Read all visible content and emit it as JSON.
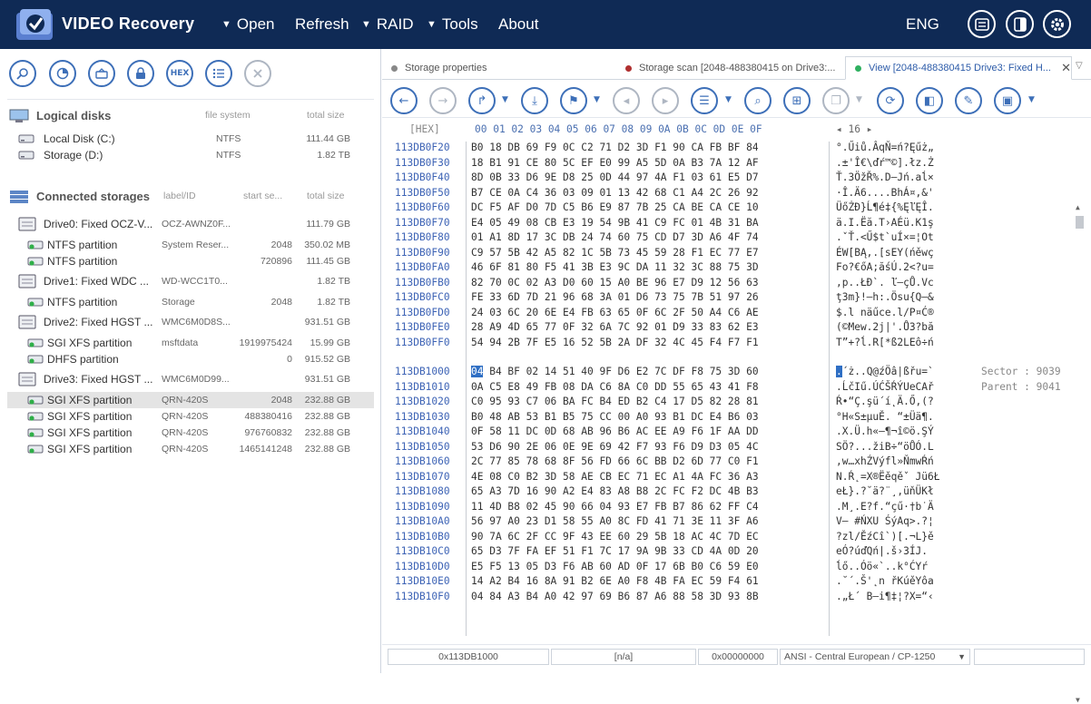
{
  "app": {
    "title": "VIDEO Recovery"
  },
  "menu": [
    {
      "label": "Open",
      "has_arrow": true
    },
    {
      "label": "Refresh",
      "has_arrow": false
    },
    {
      "label": "RAID",
      "has_arrow": true
    },
    {
      "label": "Tools",
      "has_arrow": true
    },
    {
      "label": "About",
      "has_arrow": false
    }
  ],
  "lang": "ENG",
  "left_toolbar": {
    "hex_label": "HEX"
  },
  "logical": {
    "title": "Logical disks",
    "col_fs": "file system",
    "col_size": "total size",
    "items": [
      {
        "name": "Local Disk (C:)",
        "fs": "NTFS",
        "size": "111.44 GB"
      },
      {
        "name": "Storage (D:)",
        "fs": "NTFS",
        "size": "1.82 TB"
      }
    ]
  },
  "storages": {
    "title": "Connected storages",
    "col_label": "label/ID",
    "col_start": "start se...",
    "col_size": "total size",
    "items": [
      {
        "kind": "drive",
        "name": "Drive0: Fixed OCZ-V...",
        "label": "OCZ-AWNZ0F...",
        "start": "",
        "size": "111.79 GB"
      },
      {
        "kind": "part",
        "name": "NTFS partition",
        "label": "System Reser...",
        "start": "2048",
        "size": "350.02 MB"
      },
      {
        "kind": "part",
        "name": "NTFS partition",
        "label": "",
        "start": "720896",
        "size": "111.45 GB"
      },
      {
        "kind": "drive",
        "name": "Drive1: Fixed WDC ...",
        "label": "WD-WCC1T0...",
        "start": "",
        "size": "1.82 TB"
      },
      {
        "kind": "part",
        "name": "NTFS partition",
        "label": "Storage",
        "start": "2048",
        "size": "1.82 TB"
      },
      {
        "kind": "drive",
        "name": "Drive2: Fixed HGST ...",
        "label": "WMC6M0D8S...",
        "start": "",
        "size": "931.51 GB"
      },
      {
        "kind": "part",
        "name": "SGI XFS partition",
        "label": "msftdata",
        "start": "1919975424",
        "size": "15.99 GB"
      },
      {
        "kind": "part",
        "name": "DHFS partition",
        "label": "",
        "start": "0",
        "size": "915.52 GB"
      },
      {
        "kind": "drive",
        "name": "Drive3: Fixed HGST ...",
        "label": "WMC6M0D99...",
        "start": "",
        "size": "931.51 GB"
      },
      {
        "kind": "part",
        "name": "SGI XFS partition",
        "label": "QRN-420S",
        "start": "2048",
        "size": "232.88 GB",
        "selected": true
      },
      {
        "kind": "part",
        "name": "SGI XFS partition",
        "label": "QRN-420S",
        "start": "488380416",
        "size": "232.88 GB"
      },
      {
        "kind": "part",
        "name": "SGI XFS partition",
        "label": "QRN-420S",
        "start": "976760832",
        "size": "232.88 GB"
      },
      {
        "kind": "part",
        "name": "SGI XFS partition",
        "label": "QRN-420S",
        "start": "1465141248",
        "size": "232.88 GB"
      }
    ]
  },
  "tabs": [
    {
      "label": "Storage properties",
      "color": "#888888"
    },
    {
      "label": "Storage scan [2048-488380415 on Drive3:...",
      "color": "#b03030"
    },
    {
      "label": "View [2048-488380415 Drive3: Fixed H...",
      "color": "#2fb060",
      "active": true
    }
  ],
  "hex": {
    "header_label": "[HEX]",
    "columns": "00 01 02 03 04 05 06 07 08 09 0A 0B 0C 0D 0E 0F",
    "page_indicator": "◂ 16 ▸",
    "block1": [
      {
        "addr": "113DB0F20",
        "bytes": "B0 18 DB 69 F9 0C C2 71 D2 3D F1 90 CA FB BF 84",
        "text": "°.Űiů.ÂqŇ=ń?Ęűż„"
      },
      {
        "addr": "113DB0F30",
        "bytes": "18 B1 91 CE 80 5C EF E0 99 A5 5D 0A B3 7A 12 AF",
        "text": ".±'Î€\\ďŕ™©].łz.Ż"
      },
      {
        "addr": "113DB0F40",
        "bytes": "8D 0B 33 D6 9E D8 25 0D 44 97 4A F1 03 61 E5 D7",
        "text": "Ť.3ÖžŘ%.D—Jń.aĺ×"
      },
      {
        "addr": "113DB0F50",
        "bytes": "B7 CE 0A C4 36 03 09 01 13 42 68 C1 A4 2C 26 92",
        "text": "·Î.Ä6....BhÁ¤,&'"
      },
      {
        "addr": "113DB0F60",
        "bytes": "DC F5 AF D0 7D C5 B6 E9 87 7B 25 CA BE CA CE 10",
        "text": "ÜőŻĐ}Ĺ¶é‡{%ĘľĘÎ."
      },
      {
        "addr": "113DB0F70",
        "bytes": "E4 05 49 08 CB E3 19 54 9B 41 C9 FC 01 4B 31 BA",
        "text": "ä.I.Ëă.T›AÉü.K1ş"
      },
      {
        "addr": "113DB0F80",
        "bytes": "01 A1 8D 17 3C DB 24 74 60 75 CD D7 3D A6 4F 74",
        "text": ".ˇŤ.<Ű$t`uÍ×=¦Ot"
      },
      {
        "addr": "113DB0F90",
        "bytes": "C9 57 5B 42 A5 82 1C 5B 73 45 59 28 F1 EC 77 E7",
        "text": "ÉW[BĄ‚.[sEY(ńěwç"
      },
      {
        "addr": "113DB0FA0",
        "bytes": "46 6F 81 80 F5 41 3B E3 9C DA 11 32 3C 88 75 3D",
        "text": "Fo?€őA;ăśÚ.2<?u="
      },
      {
        "addr": "113DB0FB0",
        "bytes": "82 70 0C 02 A3 D0 60 15 A0 BE 96 E7 D9 12 56 63",
        "text": "‚p..ŁĐ`. ľ–çŮ.Vc"
      },
      {
        "addr": "113DB0FC0",
        "bytes": "FE 33 6D 7D 21 96 68 3A 01 D6 73 75 7B 51 97 26",
        "text": "ţ3m}!–h:.Ösu{Q—&"
      },
      {
        "addr": "113DB0FD0",
        "bytes": "24 03 6C 20 6E E4 FB 63 65 0F 6C 2F 50 A4 C6 AE",
        "text": "$.l näűce.l/P¤Ć®"
      },
      {
        "addr": "113DB0FE0",
        "bytes": "28 A9 4D 65 77 0F 32 6A 7C 92 01 D9 33 83 62 E3",
        "text": "(©Mew.2j|'.Ů3?bă"
      },
      {
        "addr": "113DB0FF0",
        "bytes": "54 94 2B 7F E5 16 52 5B 2A DF 32 4C 45 F4 F7 F1",
        "text": "T”+?ĺ.R[*ß2LEô÷ń"
      }
    ],
    "block2": [
      {
        "addr": "113DB1000",
        "first": "04",
        "bytes": " B4 BF 02 14 51 40 9F D6 E2 7C DF F8 75 3D 60",
        "tfirst": ".",
        "text": "´ż..Q@źÖâ|ßřu=`",
        "meta": "Sector : 9039"
      },
      {
        "addr": "113DB1010",
        "bytes": "0A C5 E8 49 FB 08 DA C6 8A C0 DD 55 65 43 41 F8",
        "text": ".ĹčIű.ÚĆŠŔÝUeCAř",
        "meta": "Parent : 9041"
      },
      {
        "addr": "113DB1020",
        "bytes": "C0 95 93 C7 06 BA FC B4 ED B2 C4 17 D5 82 28 81",
        "text": "Ŕ•“Ç.şü´í˛Ä.Ő‚(?"
      },
      {
        "addr": "113DB1030",
        "bytes": "B0 48 AB 53 B1 B5 75 CC 00 A0 93 B1 DC E4 B6 03",
        "text": "°H«S±µuĚ. “±Üä¶."
      },
      {
        "addr": "113DB1040",
        "bytes": "0F 58 11 DC 0D 68 AB 96 B6 AC EE A9 F6 1F AA DD",
        "text": ".X.Ü.h«–¶¬î©ö.ŞÝ"
      },
      {
        "addr": "113DB1050",
        "bytes": "53 D6 90 2E 06 0E 9E 69 42 F7 93 F6 D9 D3 05 4C",
        "text": "SÖ?...žiB÷“öŮÓ.L"
      },
      {
        "addr": "113DB1060",
        "bytes": "2C 77 85 78 68 8F 56 FD 66 6C BB D2 6D 77 C0 F1",
        "text": ",w…xhŹVýfl»ŇmwŔń"
      },
      {
        "addr": "113DB1070",
        "bytes": "4E 08 C0 B2 3D 58 AE CB EC 71 EC A1 4A FC 36 A3",
        "text": "N.Ŕ˛=X®Ëěqěˇ Jü6Ł"
      },
      {
        "addr": "113DB1080",
        "bytes": "65 A3 7D 16 90 A2 E4 83 A8 B8 2C FC F2 DC 4B B3",
        "text": "eŁ}.?˘ä?¨¸,üňÜKł"
      },
      {
        "addr": "113DB1090",
        "bytes": "11 4D B8 02 45 90 66 04 93 E7 FB B7 86 62 FF C4",
        "text": ".M¸.E?f.“çű·†b˙Ä"
      },
      {
        "addr": "113DB10A0",
        "bytes": "56 97 A0 23 D1 58 55 A0 8C FD 41 71 3E 11 3F A6",
        "text": "V— #ŃXU ŚýAq>.?¦"
      },
      {
        "addr": "113DB10B0",
        "bytes": "90 7A 6C 2F CC 9F 43 EE 60 29 5B 18 AC 4C 7D EC",
        "text": "?zl/ĚźCî`)[.¬L}ě"
      },
      {
        "addr": "113DB10C0",
        "bytes": "65 D3 7F FA EF 51 F1 7C 17 9A 9B 33 CD 4A 0D 20",
        "text": "eÓ?úďQń|.š›3ÍJ. "
      },
      {
        "addr": "113DB10D0",
        "bytes": "E5 F5 13 05 D3 F6 AB 60 AD 0F 17 6B B0 C6 59 E0",
        "text": "ĺő..Óö«`­..k°ĆYŕ"
      },
      {
        "addr": "113DB10E0",
        "bytes": "14 A2 B4 16 8A 91 B2 6E A0 F8 4B FA EC 59 F4 61",
        "text": ".˘´.Š'˛n řKúěYôa"
      },
      {
        "addr": "113DB10F0",
        "bytes": "04 84 A3 B4 A0 42 97 69 B6 87 A6 88 58 3D 93 8B",
        "text": ".„Ł´ B—i¶‡¦?X=“‹"
      }
    ]
  },
  "status": {
    "offset": "0x113DB1000",
    "value": "[n/a]",
    "hex": "0x00000000",
    "encoding": "ANSI - Central European / CP-1250",
    "extra": ""
  }
}
